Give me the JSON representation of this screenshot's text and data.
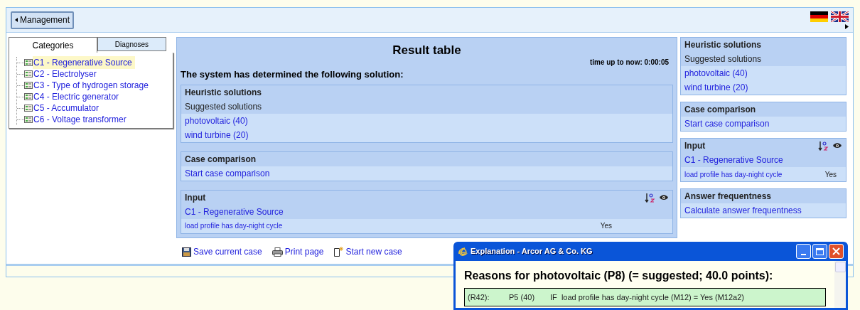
{
  "top_bar": {
    "back_button": "Management"
  },
  "tabs": [
    {
      "label": "Categories",
      "selected": true
    },
    {
      "label": "Diagnoses",
      "selected": false
    }
  ],
  "categories": [
    {
      "label": "C1 - Regenerative Source",
      "selected": true
    },
    {
      "label": "C2 - Electrolyser",
      "selected": false
    },
    {
      "label": "C3 - Type of hydrogen storage",
      "selected": false
    },
    {
      "label": "C4 - Electric generator",
      "selected": false
    },
    {
      "label": "C5 - Accumulator",
      "selected": false
    },
    {
      "label": "C6 - Voltage transformer",
      "selected": false
    }
  ],
  "result": {
    "title": "Result table",
    "timer": "time up to now: 0:00:05",
    "intro": "The system has determined the following solution:",
    "sections": [
      {
        "kind": "solutions",
        "title": "Heuristic solutions",
        "subtitle": "Suggested solutions",
        "links": [
          "photovoltaic (40)",
          "wind turbine (20)"
        ]
      },
      {
        "kind": "links",
        "title": "Case comparison",
        "links": [
          "Start case comparison"
        ]
      },
      {
        "kind": "input",
        "title": "Input",
        "group": "C1 - Regenerative Source",
        "answers": [
          {
            "question": "load profile has day-night cycle",
            "value": "Yes"
          }
        ]
      }
    ],
    "actions": [
      {
        "kind": "save",
        "label": "Save current case"
      },
      {
        "kind": "print",
        "label": "Print page"
      },
      {
        "kind": "new",
        "label": "Start new case"
      }
    ]
  },
  "sidebar": {
    "sections": [
      {
        "kind": "solutions",
        "title": "Heuristic solutions",
        "subtitle": "Suggested solutions",
        "links": [
          "photovoltaic (40)",
          "wind turbine (20)"
        ]
      },
      {
        "kind": "links",
        "title": "Case comparison",
        "links": [
          "Start case comparison"
        ]
      },
      {
        "kind": "input",
        "title": "Input",
        "group": "C1 - Regenerative Source",
        "answers": [
          {
            "question": "load profile has day-night cycle",
            "value": "Yes"
          }
        ]
      },
      {
        "kind": "links",
        "title": "Answer frequentness",
        "links": [
          "Calculate answer frequentness"
        ]
      }
    ]
  },
  "popup": {
    "title": "Explanation - Arcor AG & Co. KG",
    "heading": "Reasons for photovoltaic (P8) (= suggested; 40.0 points):",
    "rules": [
      {
        "id": "(R42):",
        "target": "P5 (40)",
        "condition": "IF  load profile has day-night cycle (M12) = Yes (M12a2)"
      }
    ]
  }
}
